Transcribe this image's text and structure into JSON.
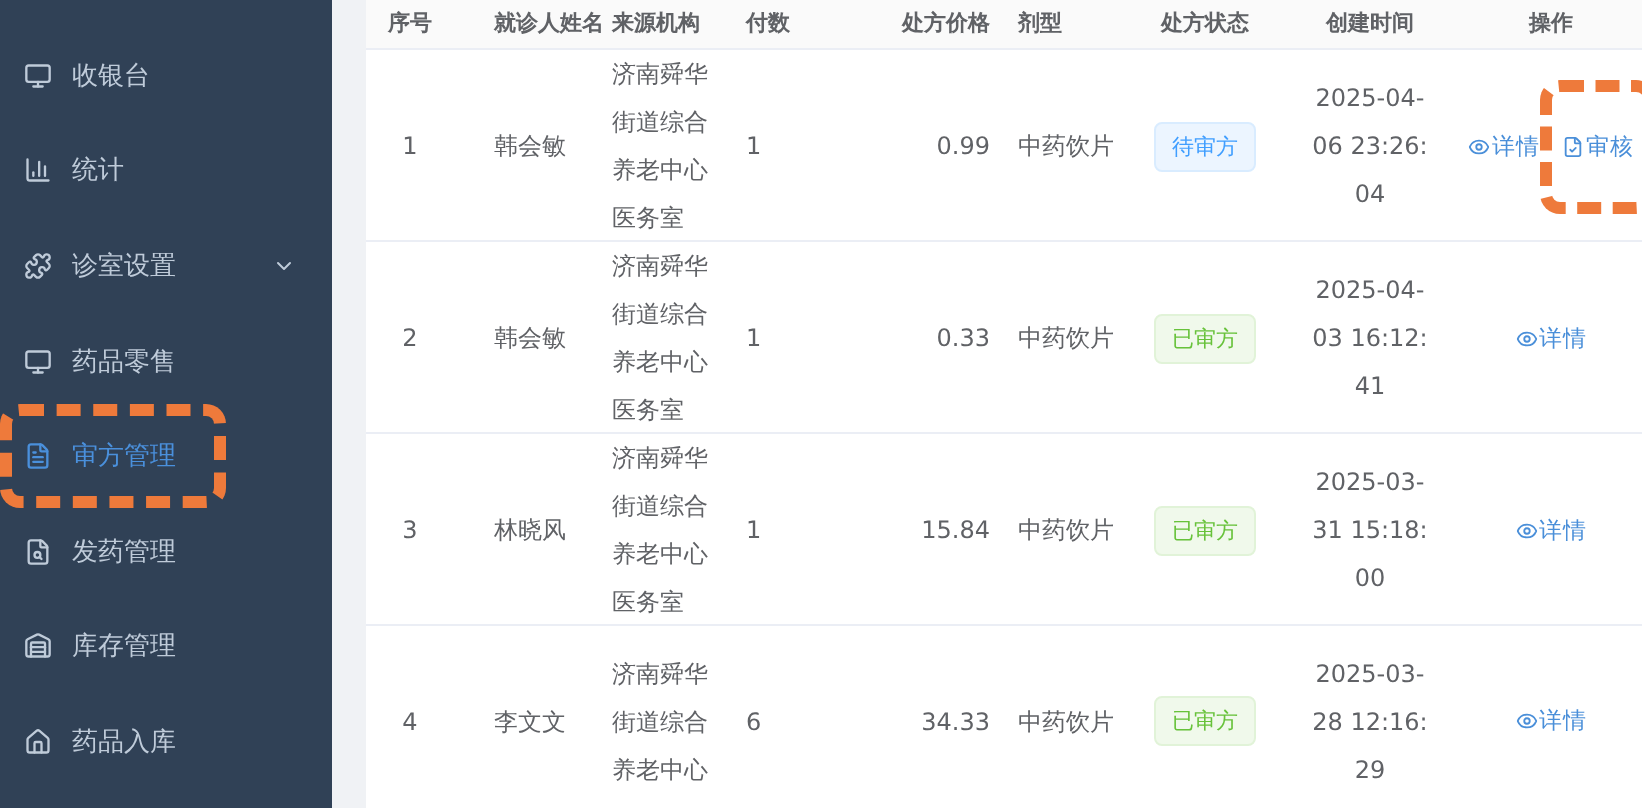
{
  "sidebar": {
    "items": [
      {
        "label": "收银台",
        "selected": false,
        "highlighted": false,
        "expandable": false
      },
      {
        "label": "统计",
        "selected": false,
        "highlighted": false,
        "expandable": false
      },
      {
        "label": "诊室设置",
        "selected": false,
        "highlighted": false,
        "expandable": true
      },
      {
        "label": "药品零售",
        "selected": false,
        "highlighted": false,
        "expandable": false
      },
      {
        "label": "审方管理",
        "selected": true,
        "highlighted": true,
        "expandable": false
      },
      {
        "label": "发药管理",
        "selected": false,
        "highlighted": false,
        "expandable": false
      },
      {
        "label": "库存管理",
        "selected": false,
        "highlighted": false,
        "expandable": false
      },
      {
        "label": "药品入库",
        "selected": false,
        "highlighted": false,
        "expandable": false
      }
    ]
  },
  "table": {
    "columns": [
      "序号",
      "就诊人姓名",
      "来源机构",
      "付数",
      "处方价格",
      "剂型",
      "处方状态",
      "创建时间",
      "操作"
    ],
    "rows": [
      {
        "no": "1",
        "patient": "韩会敏",
        "source": "济南舜华街道综合养老中心医务室",
        "doses": "1",
        "price": "0.99",
        "form": "中药饮片",
        "status": {
          "label": "待审方",
          "kind": "pending"
        },
        "created": "2025-04-06 23:26:04",
        "actions": [
          {
            "label": "详情",
            "kind": "view",
            "highlighted": false
          },
          {
            "label": "审核",
            "kind": "review",
            "highlighted": true
          }
        ]
      },
      {
        "no": "2",
        "patient": "韩会敏",
        "source": "济南舜华街道综合养老中心医务室",
        "doses": "1",
        "price": "0.33",
        "form": "中药饮片",
        "status": {
          "label": "已审方",
          "kind": "done"
        },
        "created": "2025-04-03 16:12:41",
        "actions": [
          {
            "label": "详情",
            "kind": "view",
            "highlighted": false
          }
        ]
      },
      {
        "no": "3",
        "patient": "林晓风",
        "source": "济南舜华街道综合养老中心医务室",
        "doses": "1",
        "price": "15.84",
        "form": "中药饮片",
        "status": {
          "label": "已审方",
          "kind": "done"
        },
        "created": "2025-03-31 15:18:00",
        "actions": [
          {
            "label": "详情",
            "kind": "view",
            "highlighted": false
          }
        ]
      },
      {
        "no": "4",
        "patient": "李文文",
        "source": "济南舜华街道综合养老中心",
        "doses": "6",
        "price": "34.33",
        "form": "中药饮片",
        "status": {
          "label": "已审方",
          "kind": "done"
        },
        "created": "2025-03-28 12:16:29",
        "actions": [
          {
            "label": "详情",
            "kind": "view",
            "highlighted": false
          }
        ]
      }
    ]
  }
}
